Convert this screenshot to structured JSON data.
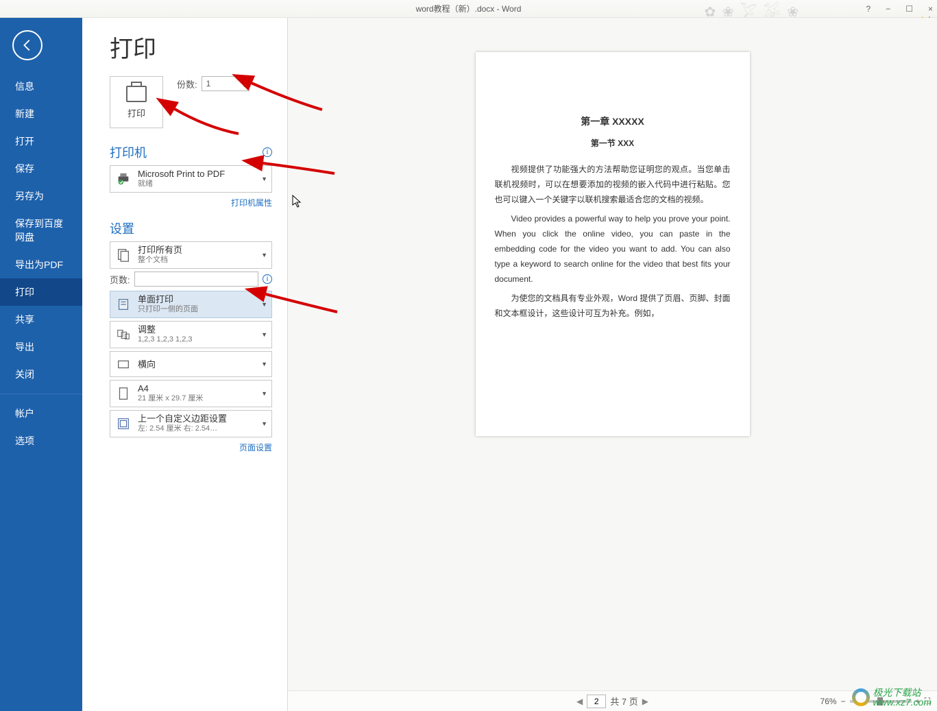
{
  "titlebar": {
    "title": "word教程（新）.docx - Word",
    "help": "?",
    "minimize": "−",
    "maximize": "☐",
    "close": "×",
    "warn_text": "bo"
  },
  "sidebar": {
    "items": [
      {
        "label": "信息"
      },
      {
        "label": "新建"
      },
      {
        "label": "打开"
      },
      {
        "label": "保存"
      },
      {
        "label": "另存为"
      },
      {
        "label": "保存到百度网盘"
      },
      {
        "label": "导出为PDF"
      },
      {
        "label": "打印",
        "active": true
      },
      {
        "label": "共享"
      },
      {
        "label": "导出"
      },
      {
        "label": "关闭"
      }
    ],
    "lower": [
      {
        "label": "帐户"
      },
      {
        "label": "选项"
      }
    ]
  },
  "pane": {
    "heading": "打印",
    "print_button": "打印",
    "copies_label": "份数:",
    "copies_value": "1",
    "printer_title": "打印机",
    "printer_name": "Microsoft Print to PDF",
    "printer_status": "就绪",
    "printer_props": "打印机属性",
    "settings_title": "设置",
    "settings": [
      {
        "l1": "打印所有页",
        "l2": "整个文档"
      },
      {
        "l1": "单面打印",
        "l2": "只打印一侧的页面",
        "highlight": true
      },
      {
        "l1": "调整",
        "l2": "1,2,3    1,2,3    1,2,3"
      },
      {
        "l1": "横向",
        "l2": ""
      },
      {
        "l1": "A4",
        "l2": "21 厘米 x 29.7 厘米"
      },
      {
        "l1": "上一个自定义边距设置",
        "l2": "左: 2.54 厘米  右: 2.54…"
      }
    ],
    "pages_label": "页数:",
    "page_setup": "页面设置"
  },
  "preview": {
    "doc": {
      "h1": "第一章 XXXXX",
      "h2": "第一节  XXX",
      "p1": "视频提供了功能强大的方法帮助您证明您的观点。当您单击联机视频时，可以在想要添加的视频的嵌入代码中进行粘贴。您也可以键入一个关键字以联机搜索最适合您的文档的视频。",
      "p2": "Video provides a powerful way to help you prove your point. When you click the online video, you can paste in the embedding code for the video you want to add. You can also type a keyword to search online for the video that best fits your document.",
      "p3": "为使您的文档具有专业外观，Word 提供了页眉、页脚、封面和文本框设计，这些设计可互为补充。例如，"
    },
    "footer": {
      "current": "2",
      "total": "共 7 页",
      "zoom": "76%"
    }
  },
  "watermark": {
    "text1": "极光下载站",
    "text2": "www.xz7.com"
  }
}
